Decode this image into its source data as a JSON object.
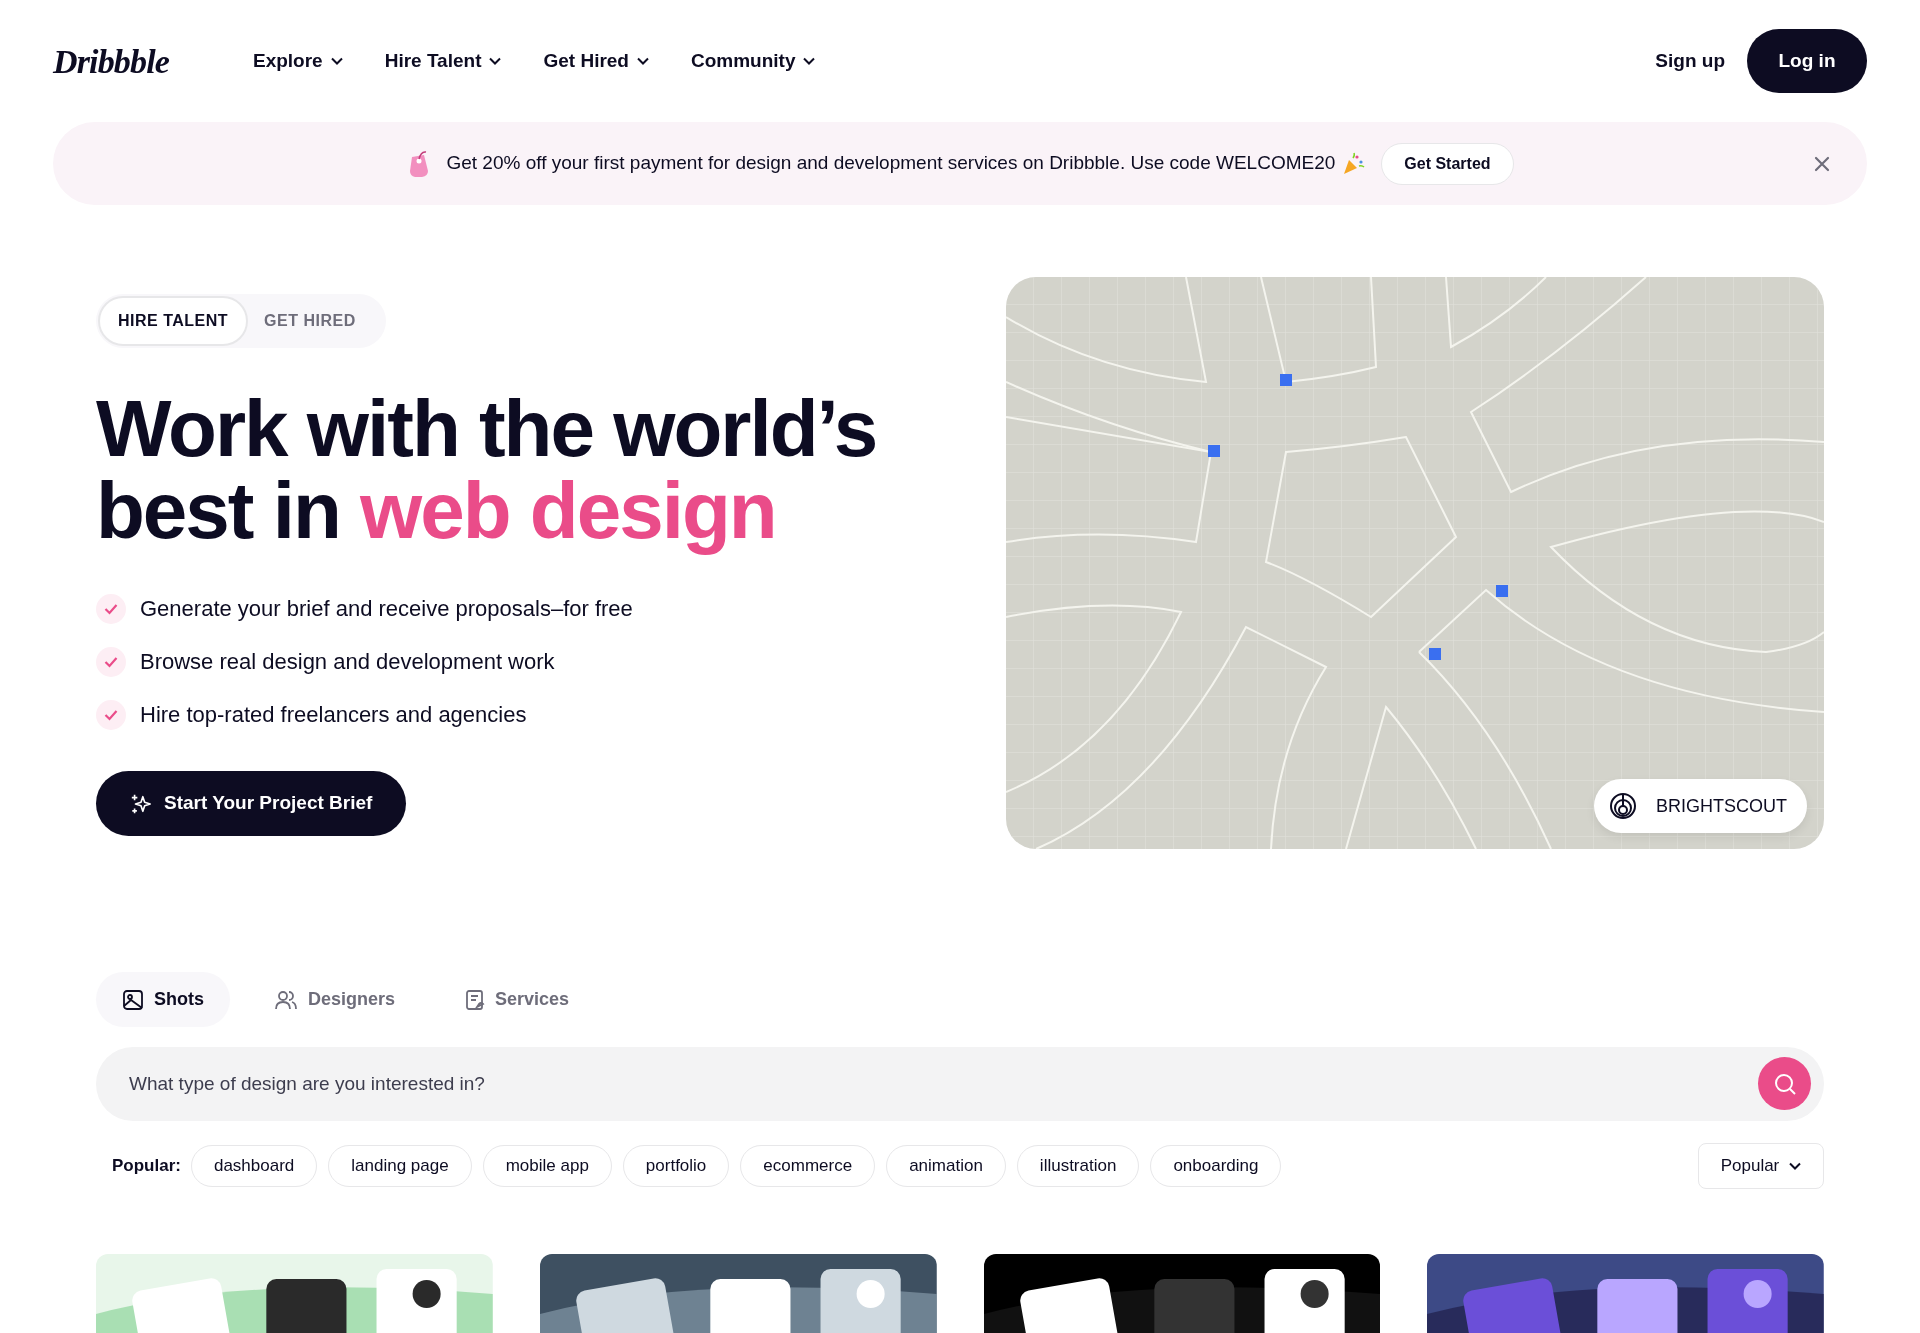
{
  "header": {
    "logo": "Dribbble",
    "nav": [
      {
        "label": "Explore"
      },
      {
        "label": "Hire Talent"
      },
      {
        "label": "Get Hired"
      },
      {
        "label": "Community"
      }
    ],
    "sign_up": "Sign up",
    "log_in": "Log in"
  },
  "banner": {
    "text": "Get 20% off your first payment for design and development services on Dribbble. Use code WELCOME20",
    "button": "Get Started"
  },
  "hero": {
    "toggle": [
      {
        "label": "HIRE TALENT",
        "selected": true
      },
      {
        "label": "GET HIRED",
        "selected": false
      }
    ],
    "title": "Work with the world’s best in",
    "title_highlight": "web design",
    "bullets": [
      "Generate your brief and receive proposals–for free",
      "Browse real design and development work",
      "Hire top-rated freelancers and agencies"
    ],
    "cta": "Start Your Project Brief",
    "showcase": {
      "kind": "picture",
      "credit": "BRIGHTSCOUT"
    }
  },
  "search_tabs": [
    {
      "label": "Shots",
      "selected": true
    },
    {
      "label": "Designers",
      "selected": false
    },
    {
      "label": "Services",
      "selected": false
    }
  ],
  "search": {
    "placeholder": "What type of design are you interested in?"
  },
  "popular": {
    "label": "Popular:",
    "tags": [
      "dashboard",
      "landing page",
      "mobile app",
      "portfolio",
      "ecommerce",
      "animation",
      "illustration",
      "onboarding"
    ]
  },
  "sort": "Popular"
}
